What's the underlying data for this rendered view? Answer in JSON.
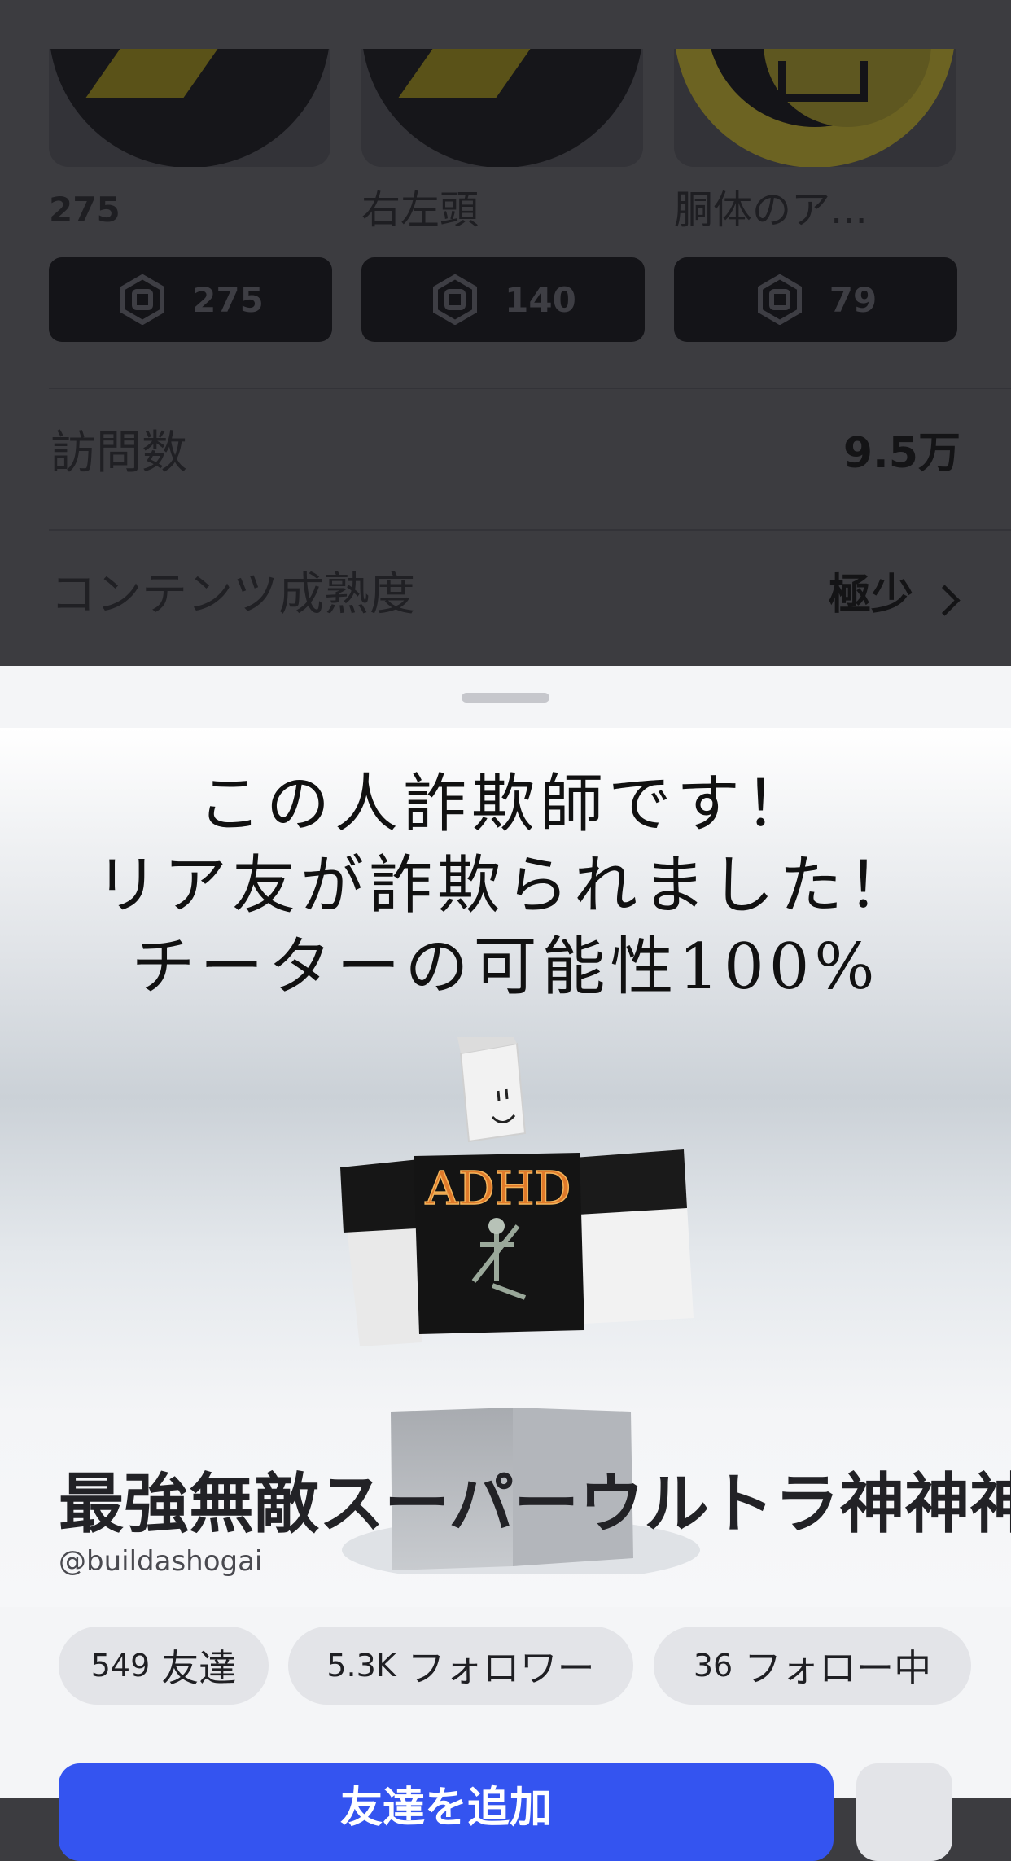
{
  "items": [
    {
      "name": "275",
      "price": "275"
    },
    {
      "name": "右左頭",
      "price": "140"
    },
    {
      "name": "胴体のア...",
      "price": "79"
    }
  ],
  "stats": {
    "visits_label": "訪問数",
    "visits_value": "9.5万",
    "maturity_label": "コンテンツ成熟度",
    "maturity_value": "極少"
  },
  "profile": {
    "about_lines": [
      "この人詐欺師です！",
      "リア友が詐欺られました！",
      "チーターの可能性100%"
    ],
    "avatar_shirt_text": "ADHD",
    "display_name": "最強無敵スーパーウルトラ神神神",
    "username": "@buildashogai",
    "friends_count": "549",
    "friends_label": "友達",
    "followers_count": "5.3K",
    "followers_label": "フォロワー",
    "following_count": "36",
    "following_label": "フォロー中",
    "add_friend_label": "友達を追加"
  },
  "colors": {
    "accent": "#3454f0",
    "pill_bg": "#e3e4e8",
    "overlay_bg": "#3c3c40"
  }
}
